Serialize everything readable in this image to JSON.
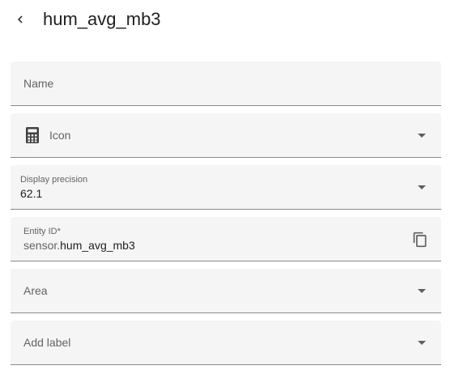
{
  "header": {
    "back_icon": "chevron-left-icon",
    "title": "hum_avg_mb3"
  },
  "form": {
    "name": {
      "label": "Name",
      "value": ""
    },
    "icon": {
      "label": "Icon",
      "icon": "calculator-icon",
      "trailing_icon": "chevron-down-icon"
    },
    "display_precision": {
      "label": "Display precision",
      "value": "62.1",
      "trailing_icon": "chevron-down-icon"
    },
    "entity_id": {
      "label": "Entity ID*",
      "prefix": "sensor.",
      "value": "hum_avg_mb3",
      "action_icon": "copy-icon"
    },
    "area": {
      "label": "Area",
      "trailing_icon": "chevron-down-icon"
    },
    "add_label": {
      "label": "Add label",
      "trailing_icon": "chevron-down-icon"
    }
  },
  "colors": {
    "field_background": "#f5f5f5",
    "field_underline": "#8a8a8a",
    "label_text": "#636363",
    "text": "#212121"
  }
}
